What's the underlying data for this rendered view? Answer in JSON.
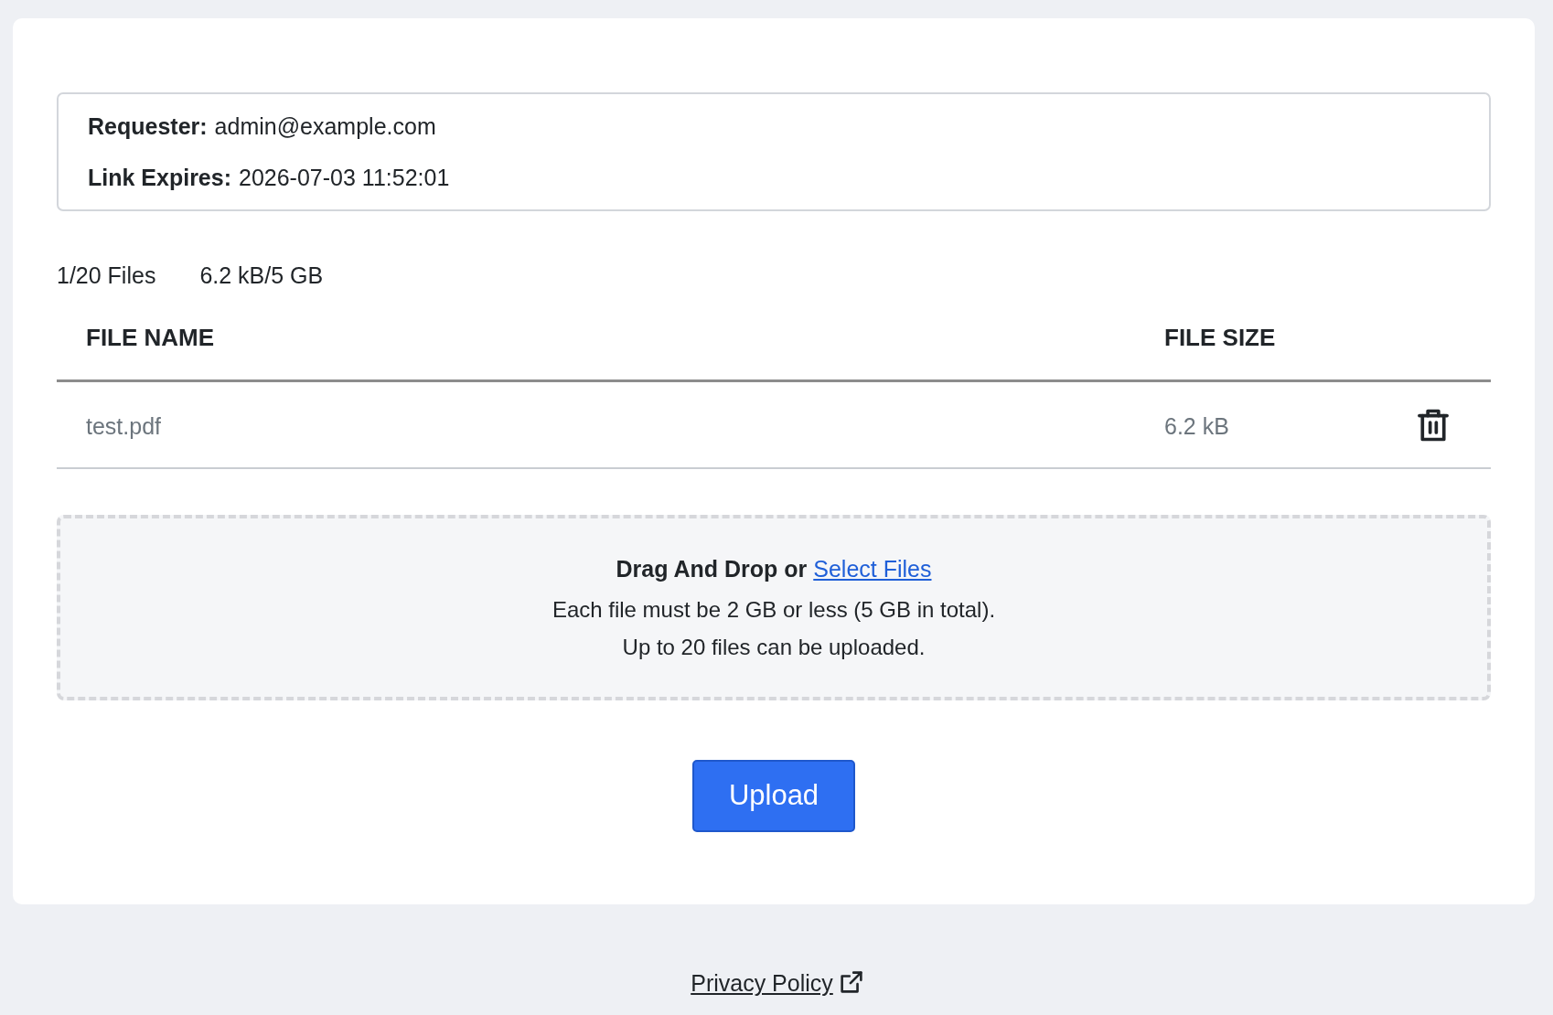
{
  "info": [
    {
      "label": "Requester:",
      "value": "admin@example.com"
    },
    {
      "label": "Link Expires:",
      "value": "2026-07-03 11:52:01"
    }
  ],
  "summary": {
    "file_count": "1/20 Files",
    "total_size": "6.2 kB/5 GB"
  },
  "table": {
    "columns": [
      "FILE NAME",
      "FILE SIZE"
    ],
    "rows": [
      {
        "name": "test.pdf",
        "size": "6.2 kB"
      }
    ]
  },
  "drop_zone": {
    "prompt": "Drag And Drop or",
    "link": "Select Files",
    "notes": [
      "Each file must be 2 GB or less (5 GB in total).",
      "Up to 20 files can be uploaded."
    ]
  },
  "upload_button": "Upload",
  "footer": {
    "link": "Privacy Policy"
  }
}
